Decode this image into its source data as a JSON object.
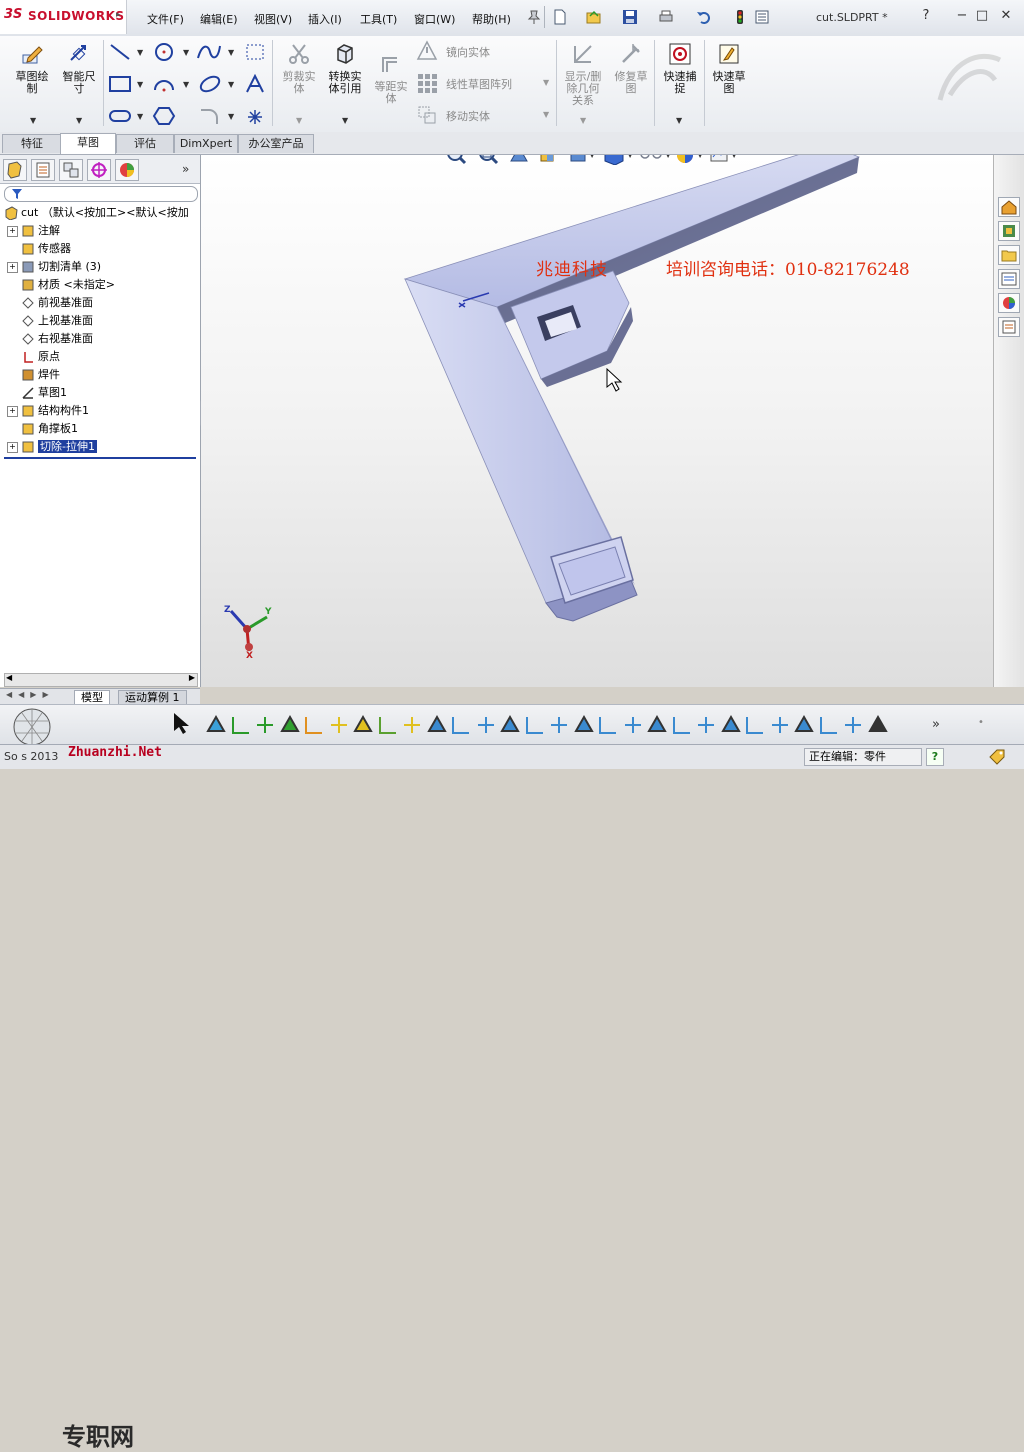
{
  "app": {
    "brand_prefix": "3S",
    "brand_name": "SOLIDWORKS",
    "document_title": "cut.SLDPRT *"
  },
  "menu": [
    "文件(F)",
    "编辑(E)",
    "视图(V)",
    "插入(I)",
    "工具(T)",
    "窗口(W)",
    "帮助(H)"
  ],
  "window_controls": {
    "help": "?",
    "minimize": "−",
    "maximize": "□",
    "close": "✕"
  },
  "command_manager": {
    "sketch": "草图绘\n制",
    "smart_dimension": "智能尺\n寸",
    "trim": "剪裁实\n体",
    "convert": "转换实\n体引用",
    "offset": "等距实\n体",
    "mirror": "镜向实体",
    "linear_pattern": "线性草图阵列",
    "move": "移动实体",
    "display_relations": "显示/删\n除几何\n关系",
    "repair": "修复草\n图",
    "quick_snaps": "快速捕\n捉",
    "rapid_sketch": "快速草\n图"
  },
  "tabs": [
    {
      "label": "特征",
      "active": false
    },
    {
      "label": "草图",
      "active": true
    },
    {
      "label": "评估",
      "active": false
    },
    {
      "label": "DimXpert",
      "active": false
    },
    {
      "label": "办公室产品",
      "active": false
    }
  ],
  "feature_tree": {
    "root": "cut  （默认<按加工><默认<按加",
    "items": [
      {
        "label": "注解",
        "expandable": true,
        "icon": "annotation-icon"
      },
      {
        "label": "传感器",
        "expandable": false,
        "icon": "sensor-icon"
      },
      {
        "label": "切割清单 (3)",
        "expandable": true,
        "icon": "cutlist-icon"
      },
      {
        "label": "材质 <未指定>",
        "expandable": false,
        "icon": "material-icon"
      },
      {
        "label": "前视基准面",
        "expandable": false,
        "icon": "plane-icon"
      },
      {
        "label": "上视基准面",
        "expandable": false,
        "icon": "plane-icon"
      },
      {
        "label": "右视基准面",
        "expandable": false,
        "icon": "plane-icon"
      },
      {
        "label": "原点",
        "expandable": false,
        "icon": "origin-icon"
      },
      {
        "label": "焊件",
        "expandable": false,
        "icon": "weldment-icon"
      },
      {
        "label": "草图1",
        "expandable": false,
        "icon": "sketch-icon"
      },
      {
        "label": "结构构件1",
        "expandable": true,
        "icon": "structural-member-icon"
      },
      {
        "label": "角撑板1",
        "expandable": false,
        "icon": "gusset-icon"
      },
      {
        "label": "切除-拉伸1",
        "expandable": true,
        "icon": "cut-extrude-icon",
        "selected": true
      }
    ]
  },
  "bottom_tabs": [
    {
      "label": "模型",
      "active": true
    },
    {
      "label": "运动算例 1",
      "active": false
    }
  ],
  "watermark": {
    "company": "兆迪科技",
    "phone": "培训咨询电话：010-82176248",
    "site_logo": "专职网",
    "site_url": "Zhuanzhi.Net",
    "status_left": "So     s 2013"
  },
  "viewport_controls": {
    "min": "−",
    "restore": "❐",
    "close": "✕"
  },
  "triad": {
    "x": "X",
    "y": "Y",
    "z": "Z"
  },
  "status": {
    "editing": "正在编辑：零件",
    "help_icon": "?"
  },
  "colors": {
    "brand": "#c8102e",
    "selection": "#1f3f9f",
    "watermark": "#e03010",
    "part": "#b9bfe6"
  }
}
